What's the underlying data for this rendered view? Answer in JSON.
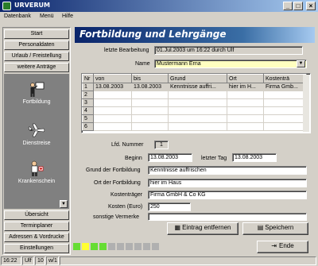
{
  "window": {
    "title": "URVERUM"
  },
  "menu": [
    "Datenbank",
    "Menü",
    "Hilfe"
  ],
  "nav": {
    "top_items": [
      "Start",
      "Personaldaten",
      "Urlaub / Freistellung",
      "weitere Anträge"
    ],
    "panel_items": [
      "Fortbildung",
      "Dienstreise",
      "Krankenschein"
    ],
    "bottom_items": [
      "Übersicht",
      "Terminplaner",
      "Adressen & Vordrucke",
      "Einstellungen"
    ]
  },
  "header": {
    "title": "Fortbildung und Lehrgänge"
  },
  "form": {
    "last_edit_label": "letzte Bearbeitung",
    "last_edit_value": "01.Jul.2003 um 16:22 durch Ulf",
    "name_label": "Name",
    "name_value": "Mustermann Erna",
    "lfd_nummer_label": "Lfd. Nummer",
    "lfd_nummer_value": "1",
    "beginn_label": "Beginn",
    "beginn_value": "13.08.2003",
    "letzter_tag_label": "letzter Tag",
    "letzter_tag_value": "13.08.2003",
    "grund_label": "Grund der Fortbildung",
    "grund_value": "Kenntnisse auffrischen",
    "ort_label": "Ort der Fortbildung",
    "ort_value": "hier im Haus",
    "kostentraeger_label": "Kostenträger",
    "kostentraeger_value": "Firma GmbH & Co KG",
    "kosten_label": "Kosten (Euro)",
    "kosten_value": "250",
    "vermerke_label": "sonstige Vermerke",
    "vermerke_value": ""
  },
  "table": {
    "headers": [
      "Nr",
      "von",
      "bis",
      "Grund",
      "Ort",
      "Kostenträ"
    ],
    "rows": [
      [
        "1",
        "13.08.2003",
        "13.08.2003",
        "Kenntnisse auffri...",
        "hier im H...",
        "Firma Gmb..."
      ],
      [
        "2",
        "",
        "",
        "",
        "",
        ""
      ],
      [
        "3",
        "",
        "",
        "",
        "",
        ""
      ],
      [
        "4",
        "",
        "",
        "",
        "",
        ""
      ],
      [
        "5",
        "",
        "",
        "",
        "",
        ""
      ],
      [
        "6",
        "",
        "",
        "",
        "",
        ""
      ]
    ]
  },
  "buttons": {
    "remove": "Eintrag entfernen",
    "save": "Speichern",
    "end": "Ende"
  },
  "status": {
    "time": "16:22",
    "user": "Ulf",
    "num": "10",
    "week": "w/1"
  },
  "colors": {
    "accent": "#0a246a",
    "green_led": "#66dd33",
    "yellow_led": "#ffff33",
    "gray_led": "#b0b0b0"
  }
}
